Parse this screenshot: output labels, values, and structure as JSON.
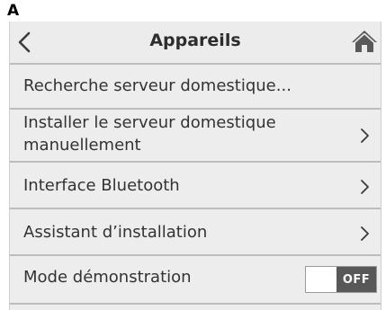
{
  "panel_label": "A",
  "header": {
    "title": "Appareils",
    "back_icon": "chevron-left-icon",
    "home_icon": "home-icon"
  },
  "menu": [
    {
      "label": "Recherche serveur domestique...",
      "chevron": false
    },
    {
      "label_line1": "Installer le serveur domestique",
      "label_line2": "manuellement",
      "chevron": true
    },
    {
      "label": "Interface Bluetooth",
      "chevron": true
    },
    {
      "label": "Assistant d’installation",
      "chevron": true
    },
    {
      "label": "Mode démonstration",
      "toggle": {
        "state": "OFF",
        "on": false
      }
    }
  ],
  "colors": {
    "background": "#ededed",
    "divider": "#bdbdbd",
    "toggle_off": "#585858"
  }
}
